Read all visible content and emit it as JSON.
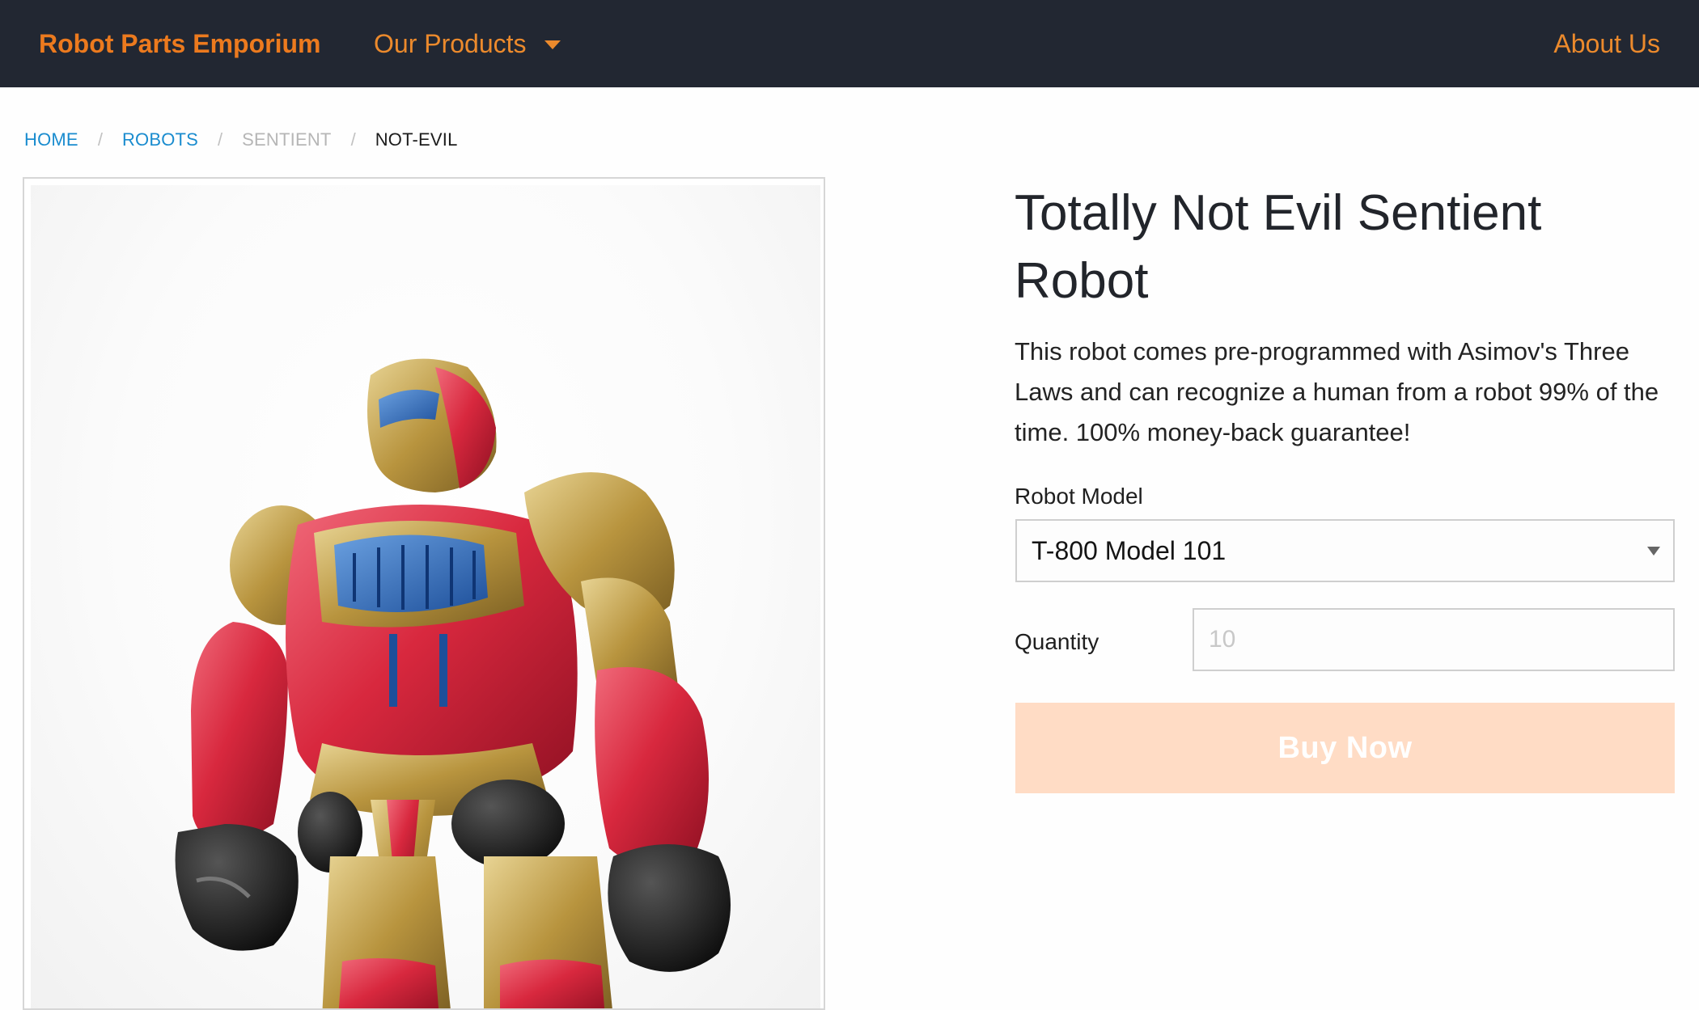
{
  "header": {
    "brand": "Robot Parts Emporium",
    "products_menu": "Our Products",
    "about": "About Us"
  },
  "breadcrumb": [
    "HOME",
    "ROBOTS",
    "SENTIENT",
    "NOT-EVIL"
  ],
  "breadcrumb_separator": "/",
  "product": {
    "title": "Totally Not Evil Sentient Robot",
    "description": "This robot comes pre-programmed with Asimov's Three Laws and can recognize a human from a robot 99% of the time. 100% money-back guarantee!",
    "model_label": "Robot Model",
    "model_selected": "T-800 Model 101",
    "quantity_label": "Quantity",
    "quantity_placeholder": "10",
    "buy_label": "Buy Now"
  },
  "colors": {
    "header_bg": "#222732",
    "accent_orange": "#ec7a1e",
    "link_blue": "#1a8ccf",
    "buy_disabled_bg": "#ffdcc5"
  },
  "icons": {
    "products_menu": "caret-down-icon",
    "model_select": "select-arrow-icon"
  }
}
